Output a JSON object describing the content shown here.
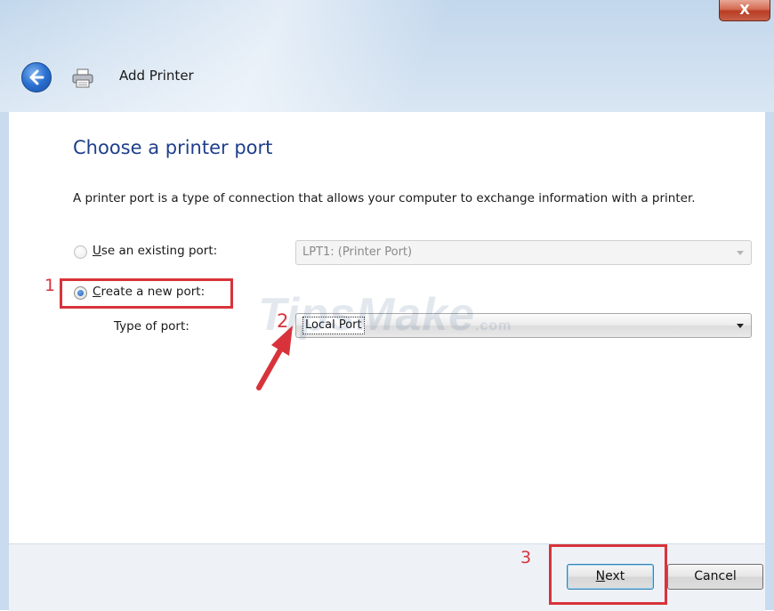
{
  "titlebar": {
    "close_label": "X",
    "title": "Add Printer"
  },
  "page": {
    "heading": "Choose a printer port",
    "description": "A printer port is a type of connection that allows your computer to exchange information with a printer."
  },
  "options": {
    "existing_port": {
      "label_accel": "U",
      "label_rest": "se an existing port:",
      "selected": false,
      "value": "LPT1: (Printer Port)"
    },
    "new_port": {
      "label_accel": "C",
      "label_rest": "reate a new port:",
      "selected": true
    },
    "type_of_port": {
      "label": "Type of port:",
      "value": "Local Port"
    }
  },
  "footer": {
    "next_accel": "N",
    "next_rest": "ext",
    "cancel_label": "Cancel"
  },
  "annotations": {
    "step1": "1",
    "step2": "2",
    "step3": "3",
    "color": "#d8333b"
  },
  "watermark": {
    "text": "TipsMake",
    "suffix": ".com"
  },
  "icons": {
    "back": "back-arrow-icon",
    "printer": "printer-icon",
    "close": "close-icon"
  }
}
